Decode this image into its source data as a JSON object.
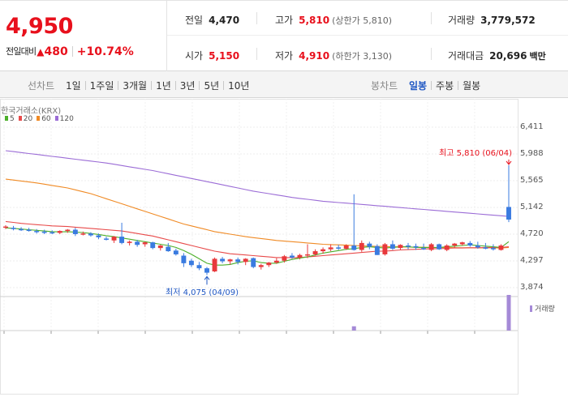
{
  "header": {
    "current_price": "4,950",
    "change_label": "전일대비",
    "change_arrow": "▲",
    "change_value": "480",
    "change_pct": "+10.74%"
  },
  "stats": {
    "prev_close": {
      "label": "전일",
      "value": "4,470"
    },
    "high": {
      "label": "고가",
      "value": "5,810",
      "sub": "(상한가 5,810)"
    },
    "volume": {
      "label": "거래량",
      "value": "3,779,572"
    },
    "open": {
      "label": "시가",
      "value": "5,150"
    },
    "low": {
      "label": "저가",
      "value": "4,910",
      "sub": "(하한가 3,130)"
    },
    "trade_value": {
      "label": "거래대금",
      "value": "20,696",
      "unit": "백만"
    }
  },
  "tabs": {
    "line_label": "선차트",
    "line": [
      "1일",
      "1주일",
      "3개월",
      "1년",
      "3년",
      "5년",
      "10년"
    ],
    "candle_label": "봉차트",
    "candle": [
      "일봉",
      "주봉",
      "월봉"
    ],
    "candle_active": 0
  },
  "chart": {
    "exchange": "한국거래소(KRX)",
    "legend": [
      {
        "label": "5",
        "color": "#4caf2a"
      },
      {
        "label": "20",
        "color": "#e84a4a"
      },
      {
        "label": "60",
        "color": "#f08a24"
      },
      {
        "label": "120",
        "color": "#9b6cd6"
      }
    ],
    "high_note": "최고 5,810 (06/04)",
    "low_note": "최저 4,075 (04/09)",
    "yticks": [
      "6,411",
      "5,988",
      "5,565",
      "5,142",
      "4,720",
      "4,297",
      "3,874"
    ],
    "volume_legend": "거래량",
    "colors": {
      "up": "#e8393c",
      "down": "#3a7be0",
      "volume": "#a58ad7"
    }
  },
  "chart_data": {
    "type": "candlestick",
    "ylim": [
      3874,
      6411
    ],
    "yticks": [
      6411,
      5988,
      5565,
      5142,
      4720,
      4297,
      3874
    ],
    "candles": [
      [
        4830,
        4860,
        4800,
        4840
      ],
      [
        4820,
        4850,
        4780,
        4800
      ],
      [
        4800,
        4830,
        4770,
        4790
      ],
      [
        4790,
        4820,
        4760,
        4770
      ],
      [
        4770,
        4800,
        4730,
        4760
      ],
      [
        4760,
        4790,
        4720,
        4740
      ],
      [
        4750,
        4780,
        4720,
        4740
      ],
      [
        4740,
        4780,
        4720,
        4770
      ],
      [
        4770,
        4800,
        4740,
        4790
      ],
      [
        4790,
        4820,
        4690,
        4720
      ],
      [
        4720,
        4760,
        4700,
        4730
      ],
      [
        4730,
        4750,
        4680,
        4700
      ],
      [
        4700,
        4730,
        4640,
        4670
      ],
      [
        4650,
        4680,
        4620,
        4640
      ],
      [
        4620,
        4690,
        4580,
        4680
      ],
      [
        4680,
        4900,
        4560,
        4580
      ],
      [
        4580,
        4620,
        4540,
        4600
      ],
      [
        4600,
        4630,
        4520,
        4550
      ],
      [
        4560,
        4600,
        4520,
        4590
      ],
      [
        4590,
        4600,
        4480,
        4500
      ],
      [
        4500,
        4550,
        4460,
        4540
      ],
      [
        4520,
        4580,
        4440,
        4450
      ],
      [
        4460,
        4490,
        4380,
        4400
      ],
      [
        4380,
        4420,
        4200,
        4260
      ],
      [
        4300,
        4330,
        4200,
        4230
      ],
      [
        4230,
        4280,
        4150,
        4180
      ],
      [
        4180,
        4200,
        4075,
        4110
      ],
      [
        4130,
        4350,
        4120,
        4330
      ],
      [
        4330,
        4360,
        4260,
        4290
      ],
      [
        4290,
        4330,
        4240,
        4320
      ],
      [
        4320,
        4350,
        4240,
        4280
      ],
      [
        4280,
        4340,
        4230,
        4330
      ],
      [
        4340,
        4350,
        4180,
        4200
      ],
      [
        4200,
        4250,
        4160,
        4230
      ],
      [
        4230,
        4280,
        4200,
        4270
      ],
      [
        4270,
        4340,
        4250,
        4300
      ],
      [
        4300,
        4390,
        4270,
        4370
      ],
      [
        4380,
        4420,
        4330,
        4350
      ],
      [
        4350,
        4410,
        4320,
        4390
      ],
      [
        4390,
        4560,
        4340,
        4400
      ],
      [
        4400,
        4480,
        4380,
        4450
      ],
      [
        4450,
        4510,
        4410,
        4480
      ],
      [
        4480,
        4560,
        4450,
        4510
      ],
      [
        4510,
        4550,
        4470,
        4490
      ],
      [
        4490,
        4560,
        4470,
        4540
      ],
      [
        4540,
        5350,
        4460,
        4470
      ],
      [
        4470,
        4620,
        4440,
        4580
      ],
      [
        4570,
        4600,
        4480,
        4520
      ],
      [
        4530,
        4560,
        4390,
        4390
      ],
      [
        4400,
        4580,
        4380,
        4560
      ],
      [
        4560,
        4620,
        4470,
        4490
      ],
      [
        4500,
        4560,
        4470,
        4550
      ],
      [
        4540,
        4580,
        4480,
        4530
      ],
      [
        4530,
        4570,
        4470,
        4510
      ],
      [
        4500,
        4570,
        4470,
        4480
      ],
      [
        4470,
        4580,
        4450,
        4560
      ],
      [
        4560,
        4570,
        4470,
        4480
      ],
      [
        4470,
        4560,
        4450,
        4540
      ],
      [
        4540,
        4580,
        4500,
        4570
      ],
      [
        4560,
        4600,
        4540,
        4590
      ],
      [
        4580,
        4610,
        4520,
        4540
      ],
      [
        4540,
        4600,
        4490,
        4510
      ],
      [
        4510,
        4580,
        4480,
        4490
      ],
      [
        4500,
        4560,
        4460,
        4480
      ],
      [
        4470,
        4560,
        4460,
        4540
      ],
      [
        5150,
        5810,
        4910,
        4950
      ]
    ],
    "ma": {
      "5": [
        4820,
        4810,
        4800,
        4790,
        4780,
        4770,
        4760,
        4755,
        4760,
        4750,
        4745,
        4730,
        4715,
        4695,
        4680,
        4660,
        4640,
        4620,
        4600,
        4580,
        4560,
        4540,
        4510,
        4460,
        4400,
        4330,
        4260,
        4230,
        4230,
        4240,
        4270,
        4290,
        4300,
        4270,
        4260,
        4260,
        4290,
        4320,
        4340,
        4360,
        4390,
        4420,
        4440,
        4460,
        4480,
        4490,
        4510,
        4520,
        4510,
        4500,
        4510,
        4520,
        4520,
        4510,
        4510,
        4510,
        4510,
        4520,
        4530,
        4540,
        4550,
        4540,
        4530,
        4520,
        4510,
        4600
      ],
      "20": [
        4920,
        4905,
        4890,
        4880,
        4870,
        4860,
        4850,
        4845,
        4840,
        4830,
        4820,
        4810,
        4800,
        4790,
        4780,
        4770,
        4750,
        4730,
        4710,
        4690,
        4660,
        4630,
        4600,
        4570,
        4540,
        4510,
        4480,
        4450,
        4430,
        4410,
        4400,
        4390,
        4380,
        4370,
        4360,
        4350,
        4350,
        4350,
        4350,
        4360,
        4370,
        4380,
        4390,
        4400,
        4410,
        4420,
        4430,
        4440,
        4450,
        4450,
        4460,
        4470,
        4475,
        4480,
        4485,
        4490,
        4490,
        4495,
        4500,
        4500,
        4505,
        4505,
        4510,
        4510,
        4510,
        4520
      ],
      "60": [
        5590,
        5575,
        5560,
        5545,
        5530,
        5510,
        5490,
        5470,
        5450,
        5420,
        5390,
        5360,
        5320,
        5280,
        5240,
        5200,
        5160,
        5120,
        5080,
        5040,
        5000,
        4960,
        4920,
        4880,
        4850,
        4820,
        4790,
        4760,
        4740,
        4720,
        4700,
        4680,
        4665,
        4650,
        4635,
        4620,
        4610,
        4600,
        4590,
        4580,
        4570,
        4560,
        4555,
        4550,
        4545,
        4540,
        4535,
        4530,
        4527,
        4523,
        4520,
        4518,
        4516,
        4514,
        4512,
        4510,
        4508,
        4507,
        4506,
        4505,
        4504,
        4503,
        4502,
        4502,
        4501,
        4510
      ],
      "120": [
        6040,
        6025,
        6010,
        5995,
        5980,
        5965,
        5950,
        5935,
        5920,
        5905,
        5890,
        5875,
        5860,
        5845,
        5825,
        5805,
        5785,
        5765,
        5745,
        5725,
        5700,
        5675,
        5650,
        5625,
        5600,
        5575,
        5550,
        5525,
        5500,
        5475,
        5450,
        5425,
        5400,
        5380,
        5360,
        5340,
        5320,
        5300,
        5285,
        5270,
        5255,
        5240,
        5230,
        5220,
        5210,
        5200,
        5190,
        5180,
        5170,
        5160,
        5150,
        5140,
        5130,
        5120,
        5110,
        5100,
        5090,
        5080,
        5070,
        5060,
        5050,
        5040,
        5030,
        5020,
        5010,
        5000
      ]
    },
    "volume": [
      0.02,
      0.02,
      0.02,
      0.02,
      0.02,
      0.02,
      0.02,
      0.02,
      0.02,
      0.02,
      0.02,
      0.02,
      0.02,
      0.02,
      0.02,
      0.02,
      0.02,
      0.02,
      0.02,
      0.02,
      0.02,
      0.02,
      0.02,
      0.02,
      0.02,
      0.02,
      0.02,
      0.02,
      0.02,
      0.02,
      0.02,
      0.02,
      0.02,
      0.02,
      0.02,
      0.02,
      0.02,
      0.02,
      0.02,
      0.02,
      0.02,
      0.02,
      0.02,
      0.02,
      0.02,
      0.12,
      0.02,
      0.02,
      0.02,
      0.02,
      0.02,
      0.02,
      0.02,
      0.02,
      0.02,
      0.02,
      0.02,
      0.02,
      0.02,
      0.02,
      0.02,
      0.02,
      0.02,
      0.02,
      0.02,
      1.0
    ]
  }
}
